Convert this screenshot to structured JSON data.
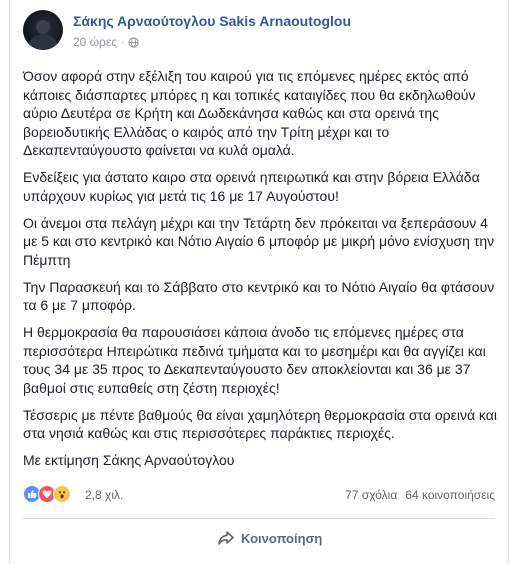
{
  "post": {
    "author": "Σάκης Αρναούτογλου Sakis Arnaoutoglou",
    "time": "20 ώρες",
    "separator": "·",
    "privacy_icon": "globe-icon",
    "paragraphs": [
      "Όσον αφορά στην εξέλιξη του καιρού για τις επόμενες ημέρες εκτός από κάποιες διάσπαρτες μπόρες η και τοπικές καταιγίδες που θα εκδηλωθούν αύριο Δευτέρα σε Κρήτη και Δωδεκάνησα καθώς και στα ορεινά της βορειοδυτικής Ελλάδας ο καιρός από την Τρίτη μέχρι και το Δεκαπενταύγουστο φαίνεται να κυλά ομαλά.",
      "Ενδείξεις για άστατο καιρο στα ορεινά ηπειρωτικά και στην βόρεια Ελλάδα υπάρχουν κυρίως για μετά τις 16 με 17 Αυγούστου!",
      "Οι άνεμοι στα πελάγη μέχρι και την Τετάρτη δεν πρόκειται να ξεπεράσουν 4 με 5 και στο κεντρικό και Νότιο Αιγαίο 6 μποφόρ με μικρή μόνο ενίσχυση την Πέμπτη",
      "Την Παρασκευή και το Σάββατο στο κεντρικό και το Νότιο Αιγαίο θα φτάσουν τα 6 με 7 μποφόρ.",
      "Η θερμοκρασία θα παρουσιάσει κάποια άνοδο τις επόμενες ημέρες στα περισσότερα Ηπειρώτικα πεδινά τμήματα και το μεσημέρι και θα αγγίζει και τους 34 με 35 προς το Δεκαπενταύγουστο δεν αποκλείονται και 36 με 37 βαθμοί στις ευπαθείς στη ζέστη περιοχές!",
      "Τέσσερις με πέντε βαθμούς θα είναι χαμηλότερη θερμοκρασία στα ορεινά και στα νησιά καθώς και στις περισσότερες παράκτιες περιοχές.",
      "Με εκτίμηση Σάκης Αρναούτογλου"
    ]
  },
  "stats": {
    "reaction_icons": [
      "like-icon",
      "love-icon",
      "wow-icon"
    ],
    "reactions_count": "2,8 χιλ.",
    "comments": "77 σχόλια",
    "shares": "64 κοινοποιήσεις"
  },
  "actions": {
    "share_label": "Κοινοποίηση",
    "share_icon": "share-arrow-icon"
  }
}
